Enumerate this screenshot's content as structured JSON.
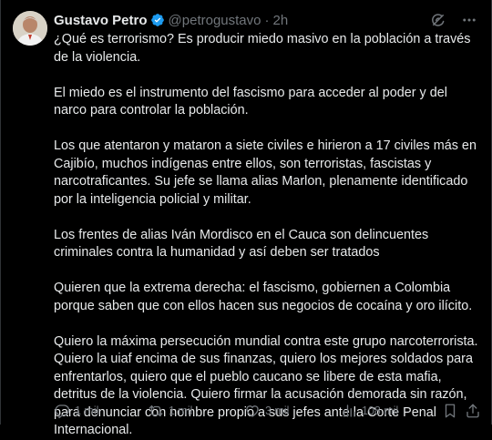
{
  "author": {
    "name": "Gustavo Petro",
    "handle": "@petrogustavo",
    "separator": "·",
    "time": "2h",
    "verified_color": "#1d9bf0"
  },
  "tweet": {
    "paragraphs": [
      "¿Qué es terrorismo? Es producir miedo masivo en la población a través de la violencia.",
      "El miedo es el instrumento del fascismo para acceder al poder y del narco para controlar la población.",
      "Los que atentaron y mataron a siete civiles e hirieron a 17 civiles más en Cajibío, muchos indígenas entre ellos, son terroristas, fascistas y narcotraficantes. Su jefe se llama alias Marlon, plenamente identificado por la inteligencia policial y militar.",
      "Los frentes de alias Iván Mordisco en el Cauca son delincuentes criminales contra la humanidad y así deben ser tratados",
      "Quieren que la extrema derecha: el fascismo, gobiernen a Colombia porque saben que con ellos hacen sus negocios de cocaína y oro ilícito.",
      "Quiero la máxima persecución mundial contra este grupo narcoterrorista. Quiero la uiaf encima de sus finanzas, quiero los mejores soldados para enfrentarlos, quiero que el pueblo caucano se libere de esta mafia, detritus de la violencia. Quiero firmar la acusación demorada sin razón, para denunciar con nombre propio a sus jefes ante la Corte Penal Internacional."
    ]
  },
  "actions": {
    "replies": "1 mil",
    "reposts": "1 mil",
    "likes": "3 mil",
    "views": "108 mil"
  },
  "icons": {
    "header": [
      "grok-icon",
      "more-icon"
    ],
    "bar": [
      "reply-icon",
      "repost-icon",
      "like-icon",
      "views-icon",
      "bookmark-icon",
      "share-icon"
    ]
  },
  "colors": {
    "background": "#000000",
    "text": "#e7e9ea",
    "muted": "#71767b",
    "accent": "#1d9bf0"
  }
}
